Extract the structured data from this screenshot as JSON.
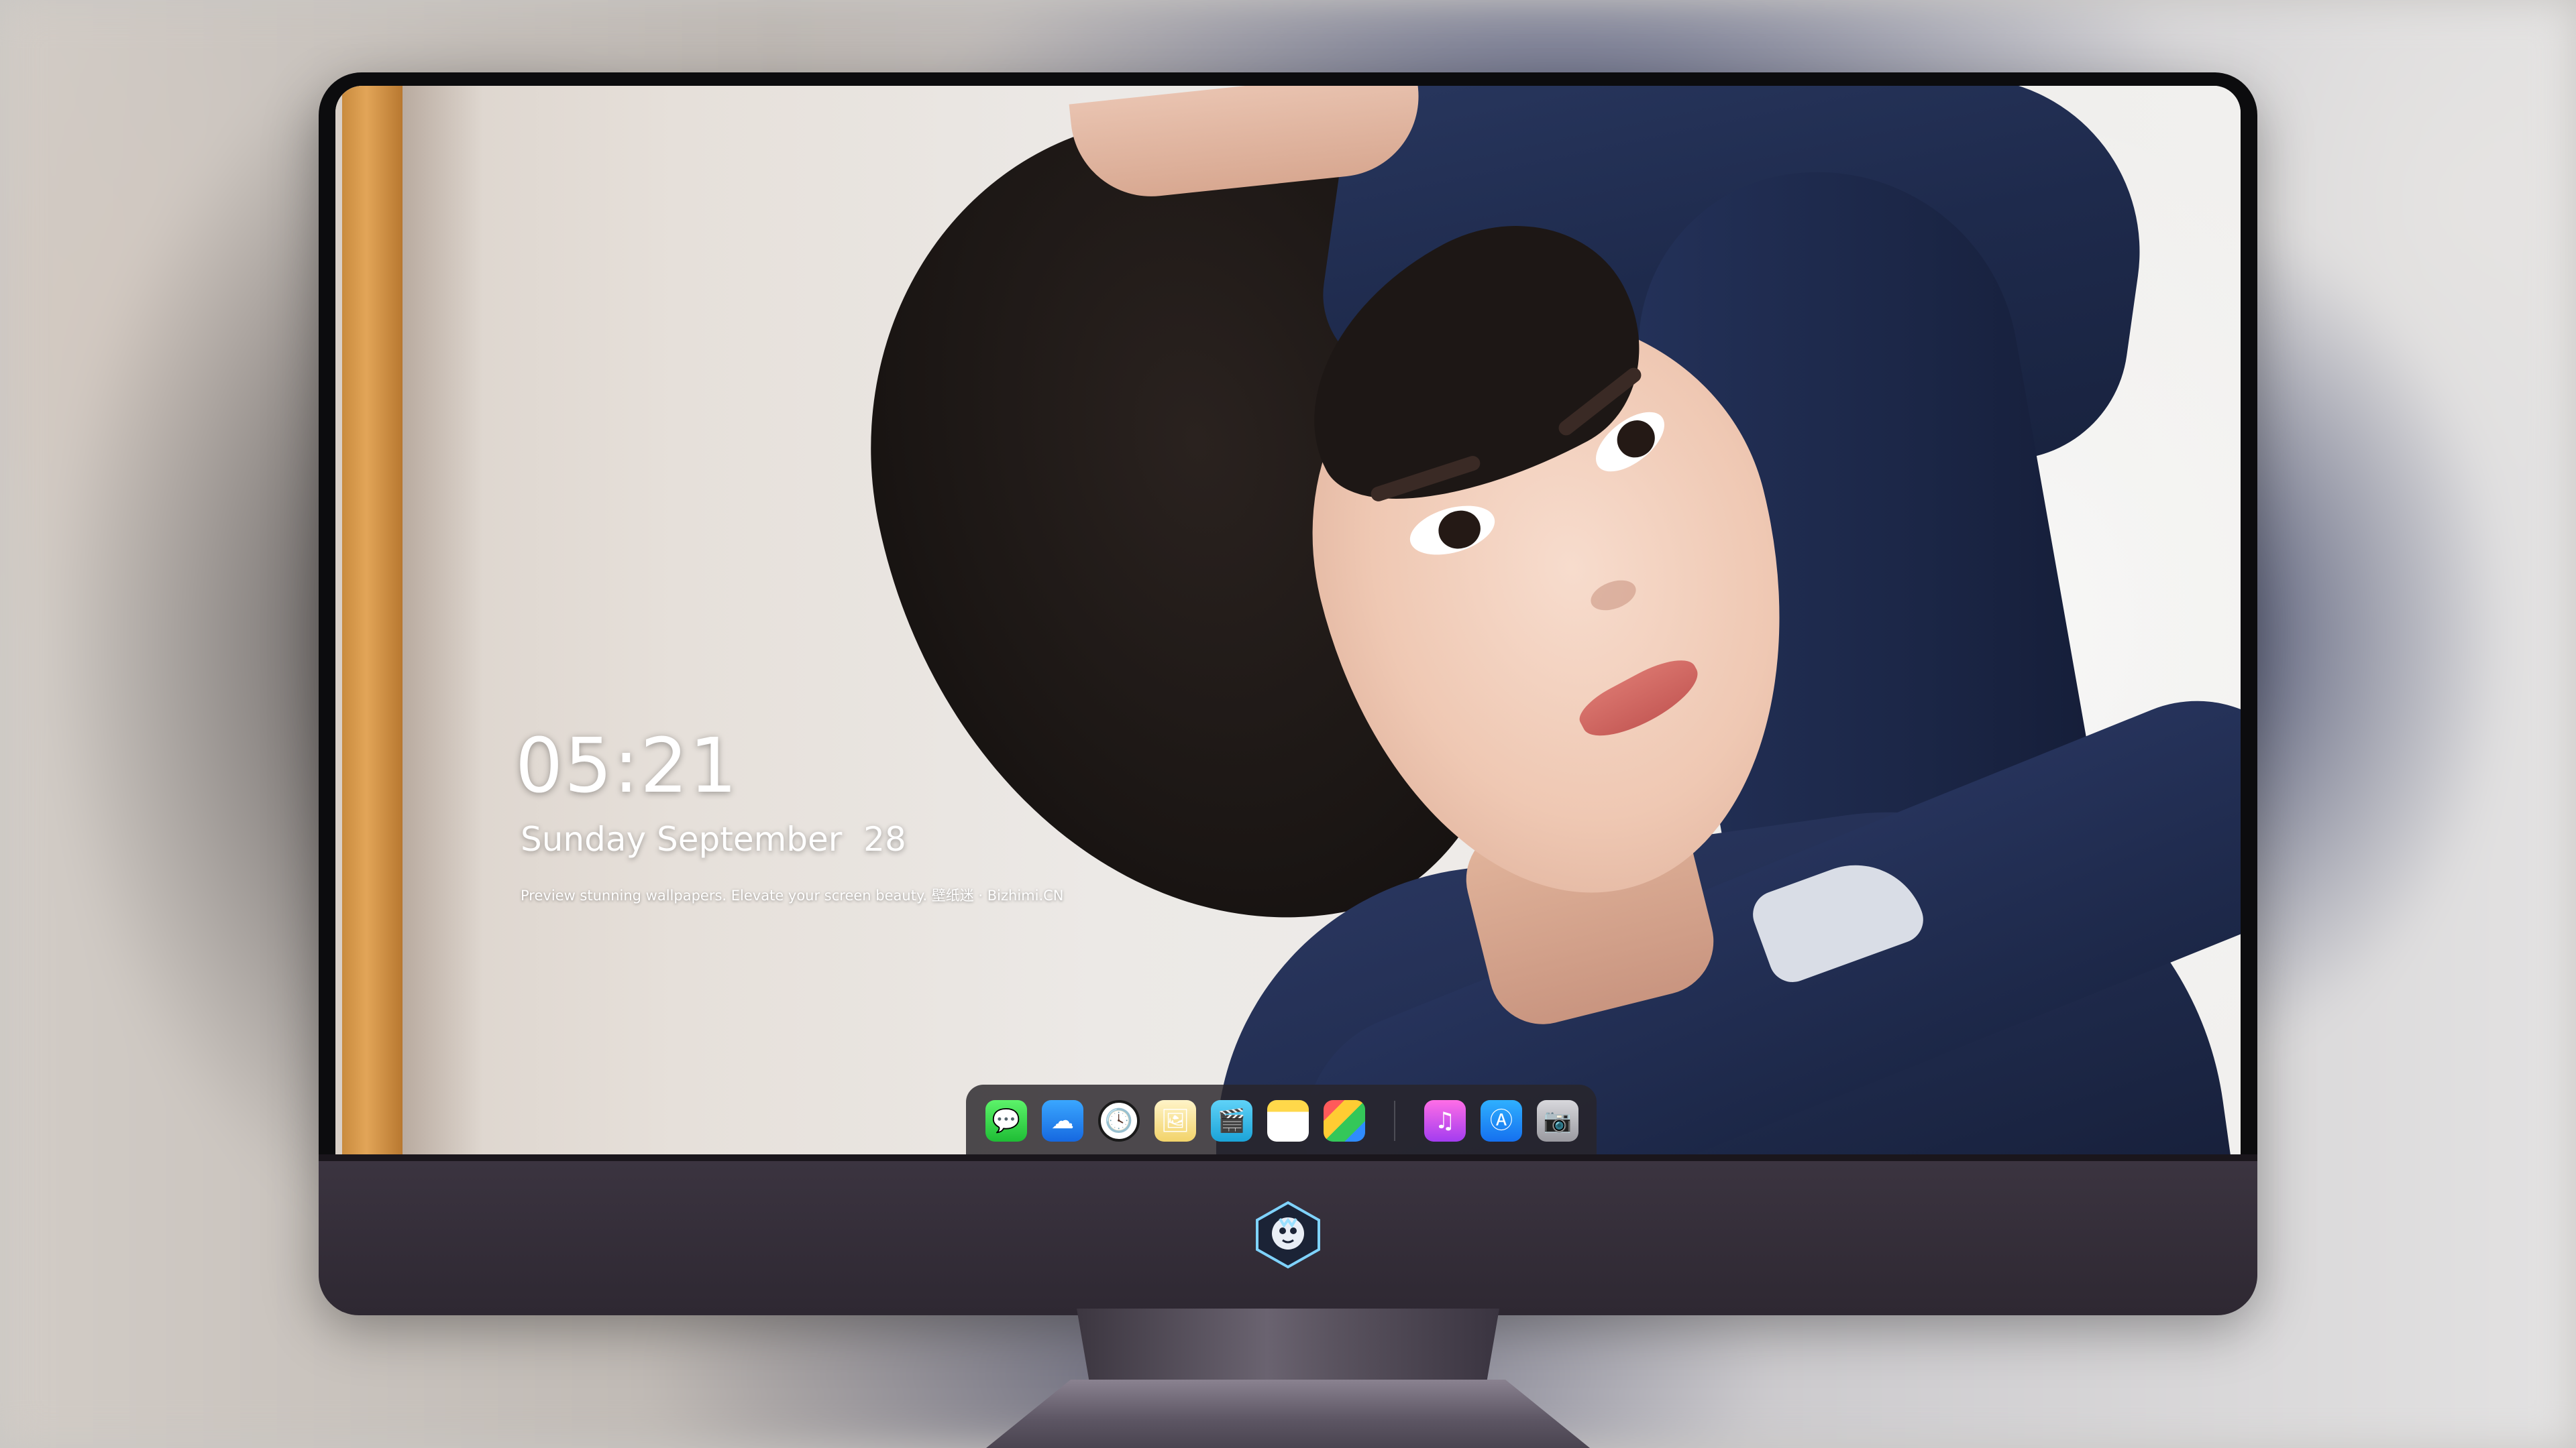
{
  "lock_screen": {
    "time": "05:21",
    "date": "Sunday September  28",
    "tagline": "Preview stunning wallpapers. Elevate your screen beauty. 壁纸迷 · Bizhimi.CN"
  },
  "dock": {
    "apps": [
      {
        "name": "messages-icon",
        "glyph": "💬"
      },
      {
        "name": "weather-icon",
        "glyph": "☁"
      },
      {
        "name": "clock-icon",
        "glyph": "🕓"
      },
      {
        "name": "preview-icon",
        "glyph": "🖼"
      },
      {
        "name": "clips-icon",
        "glyph": "🎬"
      },
      {
        "name": "notes-icon",
        "glyph": ""
      },
      {
        "name": "photos-icon",
        "glyph": ""
      }
    ],
    "secondary_apps": [
      {
        "name": "music-icon",
        "glyph": "♫"
      },
      {
        "name": "app-store-icon",
        "glyph": "Ⓐ"
      },
      {
        "name": "camera-icon",
        "glyph": "📷"
      }
    ]
  },
  "colors": {
    "dock_background": "#28242a",
    "monitor_chin": "#3b3440",
    "monitor_bezel": "#0c0c0e"
  }
}
